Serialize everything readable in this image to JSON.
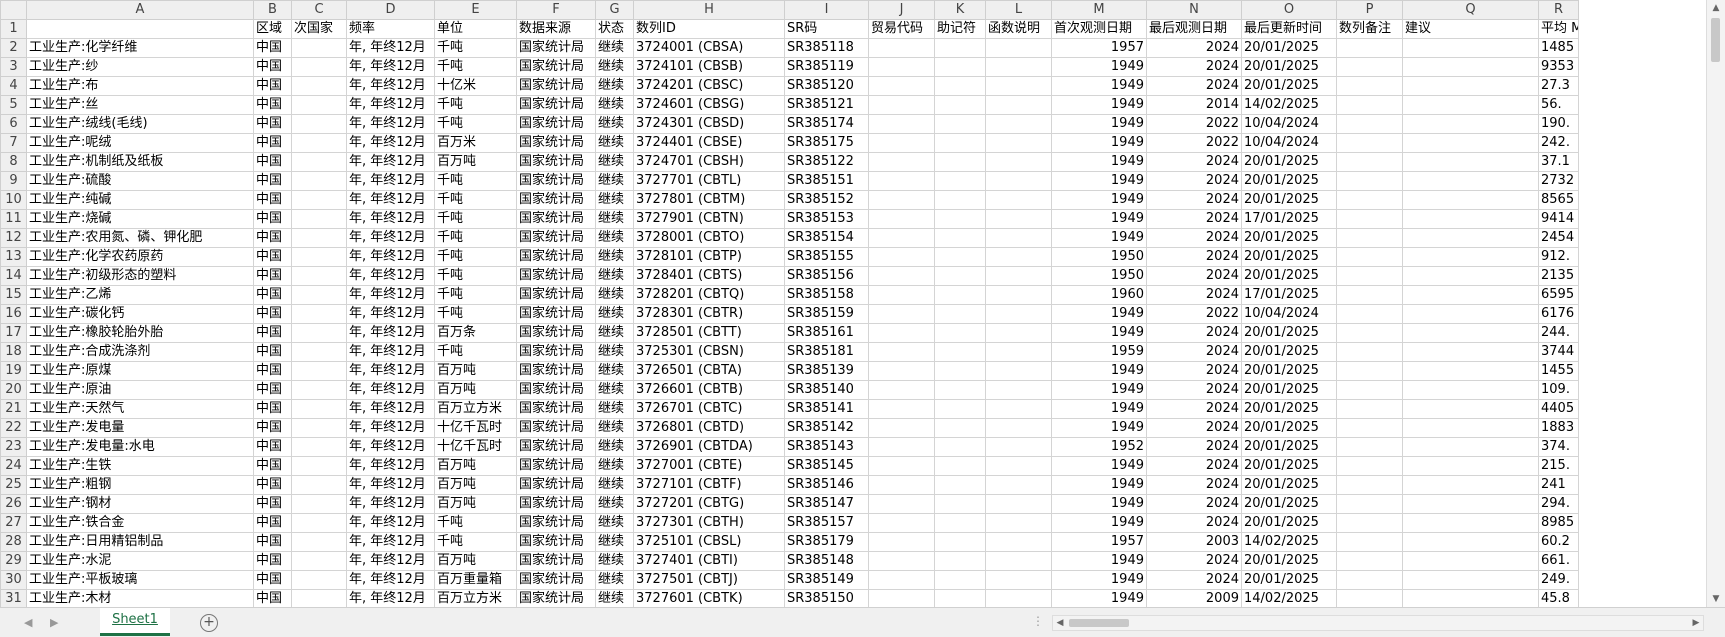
{
  "columns": [
    "",
    "A",
    "B",
    "C",
    "D",
    "E",
    "F",
    "G",
    "H",
    "I",
    "J",
    "K",
    "L",
    "M",
    "N",
    "O",
    "P",
    "Q",
    "R"
  ],
  "rows": [
    {
      "n": "1",
      "cells": [
        "",
        "区域",
        "次国家",
        "频率",
        "单位",
        "数据来源",
        "状态",
        "数列ID",
        "SR码",
        "贸易代码",
        "助记符",
        "函数说明",
        "首次观测日期",
        "最后观测日期",
        "最后更新时间",
        "数列备注",
        "建议",
        "平均 M"
      ]
    },
    {
      "n": "2",
      "cells": [
        "工业生产:化学纤维",
        "中国",
        "",
        "年, 年终12月",
        "千吨",
        "国家统计局",
        "继续",
        "3724001 (CBSA)",
        "SR385118",
        "",
        "",
        "",
        "1957",
        "2024",
        "20/01/2025",
        "",
        "",
        "1485"
      ]
    },
    {
      "n": "3",
      "cells": [
        "工业生产:纱",
        "中国",
        "",
        "年, 年终12月",
        "千吨",
        "国家统计局",
        "继续",
        "3724101 (CBSB)",
        "SR385119",
        "",
        "",
        "",
        "1949",
        "2024",
        "20/01/2025",
        "",
        "",
        "9353"
      ]
    },
    {
      "n": "4",
      "cells": [
        "工业生产:布",
        "中国",
        "",
        "年, 年终12月",
        "十亿米",
        "国家统计局",
        "继续",
        "3724201 (CBSC)",
        "SR385120",
        "",
        "",
        "",
        "1949",
        "2024",
        "20/01/2025",
        "",
        "",
        "27.3"
      ]
    },
    {
      "n": "5",
      "cells": [
        "工业生产:丝",
        "中国",
        "",
        "年, 年终12月",
        "千吨",
        "国家统计局",
        "继续",
        "3724601 (CBSG)",
        "SR385121",
        "",
        "",
        "",
        "1949",
        "2014",
        "14/02/2025",
        "",
        "",
        "56."
      ]
    },
    {
      "n": "6",
      "cells": [
        "工业生产:绒线(毛线)",
        "中国",
        "",
        "年, 年终12月",
        "千吨",
        "国家统计局",
        "继续",
        "3724301 (CBSD)",
        "SR385174",
        "",
        "",
        "",
        "1949",
        "2022",
        "10/04/2024",
        "",
        "",
        "190."
      ]
    },
    {
      "n": "7",
      "cells": [
        "工业生产:呢绒",
        "中国",
        "",
        "年, 年终12月",
        "百万米",
        "国家统计局",
        "继续",
        "3724401 (CBSE)",
        "SR385175",
        "",
        "",
        "",
        "1949",
        "2022",
        "10/04/2024",
        "",
        "",
        "242."
      ]
    },
    {
      "n": "8",
      "cells": [
        "工业生产:机制纸及纸板",
        "中国",
        "",
        "年, 年终12月",
        "百万吨",
        "国家统计局",
        "继续",
        "3724701 (CBSH)",
        "SR385122",
        "",
        "",
        "",
        "1949",
        "2024",
        "20/01/2025",
        "",
        "",
        "37.1"
      ]
    },
    {
      "n": "9",
      "cells": [
        "工业生产:硫酸",
        "中国",
        "",
        "年, 年终12月",
        "千吨",
        "国家统计局",
        "继续",
        "3727701 (CBTL)",
        "SR385151",
        "",
        "",
        "",
        "1949",
        "2024",
        "20/01/2025",
        "",
        "",
        "2732"
      ]
    },
    {
      "n": "10",
      "cells": [
        "工业生产:纯碱",
        "中国",
        "",
        "年, 年终12月",
        "千吨",
        "国家统计局",
        "继续",
        "3727801 (CBTM)",
        "SR385152",
        "",
        "",
        "",
        "1949",
        "2024",
        "20/01/2025",
        "",
        "",
        "8565"
      ]
    },
    {
      "n": "11",
      "cells": [
        "工业生产:烧碱",
        "中国",
        "",
        "年, 年终12月",
        "千吨",
        "国家统计局",
        "继续",
        "3727901 (CBTN)",
        "SR385153",
        "",
        "",
        "",
        "1949",
        "2024",
        "17/01/2025",
        "",
        "",
        "9414"
      ]
    },
    {
      "n": "12",
      "cells": [
        "工业生产:农用氮、磷、钾化肥",
        "中国",
        "",
        "年, 年终12月",
        "千吨",
        "国家统计局",
        "继续",
        "3728001 (CBTO)",
        "SR385154",
        "",
        "",
        "",
        "1949",
        "2024",
        "20/01/2025",
        "",
        "",
        "2454"
      ]
    },
    {
      "n": "13",
      "cells": [
        "工业生产:化学农药原药",
        "中国",
        "",
        "年, 年终12月",
        "千吨",
        "国家统计局",
        "继续",
        "3728101 (CBTP)",
        "SR385155",
        "",
        "",
        "",
        "1950",
        "2024",
        "20/01/2025",
        "",
        "",
        "912."
      ]
    },
    {
      "n": "14",
      "cells": [
        "工业生产:初级形态的塑料",
        "中国",
        "",
        "年, 年终12月",
        "千吨",
        "国家统计局",
        "继续",
        "3728401 (CBTS)",
        "SR385156",
        "",
        "",
        "",
        "1950",
        "2024",
        "20/01/2025",
        "",
        "",
        "2135"
      ]
    },
    {
      "n": "15",
      "cells": [
        "工业生产:乙烯",
        "中国",
        "",
        "年, 年终12月",
        "千吨",
        "国家统计局",
        "继续",
        "3728201 (CBTQ)",
        "SR385158",
        "",
        "",
        "",
        "1960",
        "2024",
        "17/01/2025",
        "",
        "",
        "6595"
      ]
    },
    {
      "n": "16",
      "cells": [
        "工业生产:碳化钙",
        "中国",
        "",
        "年, 年终12月",
        "千吨",
        "国家统计局",
        "继续",
        "3728301 (CBTR)",
        "SR385159",
        "",
        "",
        "",
        "1949",
        "2022",
        "10/04/2024",
        "",
        "",
        "6176"
      ]
    },
    {
      "n": "17",
      "cells": [
        "工业生产:橡胶轮胎外胎",
        "中国",
        "",
        "年, 年终12月",
        "百万条",
        "国家统计局",
        "继续",
        "3728501 (CBTT)",
        "SR385161",
        "",
        "",
        "",
        "1949",
        "2024",
        "20/01/2025",
        "",
        "",
        "244."
      ]
    },
    {
      "n": "18",
      "cells": [
        "工业生产:合成洗涤剂",
        "中国",
        "",
        "年, 年终12月",
        "千吨",
        "国家统计局",
        "继续",
        "3725301 (CBSN)",
        "SR385181",
        "",
        "",
        "",
        "1959",
        "2024",
        "20/01/2025",
        "",
        "",
        "3744"
      ]
    },
    {
      "n": "19",
      "cells": [
        "工业生产:原煤",
        "中国",
        "",
        "年, 年终12月",
        "百万吨",
        "国家统计局",
        "继续",
        "3726501 (CBTA)",
        "SR385139",
        "",
        "",
        "",
        "1949",
        "2024",
        "20/01/2025",
        "",
        "",
        "1455"
      ]
    },
    {
      "n": "20",
      "cells": [
        "工业生产:原油",
        "中国",
        "",
        "年, 年终12月",
        "百万吨",
        "国家统计局",
        "继续",
        "3726601 (CBTB)",
        "SR385140",
        "",
        "",
        "",
        "1949",
        "2024",
        "20/01/2025",
        "",
        "",
        "109."
      ]
    },
    {
      "n": "21",
      "cells": [
        "工业生产:天然气",
        "中国",
        "",
        "年, 年终12月",
        "百万立方米",
        "国家统计局",
        "继续",
        "3726701 (CBTC)",
        "SR385141",
        "",
        "",
        "",
        "1949",
        "2024",
        "20/01/2025",
        "",
        "",
        "4405"
      ]
    },
    {
      "n": "22",
      "cells": [
        "工业生产:发电量",
        "中国",
        "",
        "年, 年终12月",
        "十亿千瓦时",
        "国家统计局",
        "继续",
        "3726801 (CBTD)",
        "SR385142",
        "",
        "",
        "",
        "1949",
        "2024",
        "20/01/2025",
        "",
        "",
        "1883"
      ]
    },
    {
      "n": "23",
      "cells": [
        "工业生产:发电量:水电",
        "中国",
        "",
        "年, 年终12月",
        "十亿千瓦时",
        "国家统计局",
        "继续",
        "3726901 (CBTDA)",
        "SR385143",
        "",
        "",
        "",
        "1952",
        "2024",
        "20/01/2025",
        "",
        "",
        "374."
      ]
    },
    {
      "n": "24",
      "cells": [
        "工业生产:生铁",
        "中国",
        "",
        "年, 年终12月",
        "百万吨",
        "国家统计局",
        "继续",
        "3727001 (CBTE)",
        "SR385145",
        "",
        "",
        "",
        "1949",
        "2024",
        "20/01/2025",
        "",
        "",
        "215."
      ]
    },
    {
      "n": "25",
      "cells": [
        "工业生产:粗钢",
        "中国",
        "",
        "年, 年终12月",
        "百万吨",
        "国家统计局",
        "继续",
        "3727101 (CBTF)",
        "SR385146",
        "",
        "",
        "",
        "1949",
        "2024",
        "20/01/2025",
        "",
        "",
        "241"
      ]
    },
    {
      "n": "26",
      "cells": [
        "工业生产:钢材",
        "中国",
        "",
        "年, 年终12月",
        "百万吨",
        "国家统计局",
        "继续",
        "3727201 (CBTG)",
        "SR385147",
        "",
        "",
        "",
        "1949",
        "2024",
        "20/01/2025",
        "",
        "",
        "294."
      ]
    },
    {
      "n": "27",
      "cells": [
        "工业生产:铁合金",
        "中国",
        "",
        "年, 年终12月",
        "千吨",
        "国家统计局",
        "继续",
        "3727301 (CBTH)",
        "SR385157",
        "",
        "",
        "",
        "1949",
        "2024",
        "20/01/2025",
        "",
        "",
        "8985"
      ]
    },
    {
      "n": "28",
      "cells": [
        "工业生产:日用精铝制品",
        "中国",
        "",
        "年, 年终12月",
        "千吨",
        "国家统计局",
        "继续",
        "3725101 (CBSL)",
        "SR385179",
        "",
        "",
        "",
        "1957",
        "2003",
        "14/02/2025",
        "",
        "",
        "60.2"
      ]
    },
    {
      "n": "29",
      "cells": [
        "工业生产:水泥",
        "中国",
        "",
        "年, 年终12月",
        "百万吨",
        "国家统计局",
        "继续",
        "3727401 (CBTI)",
        "SR385148",
        "",
        "",
        "",
        "1949",
        "2024",
        "20/01/2025",
        "",
        "",
        "661."
      ]
    },
    {
      "n": "30",
      "cells": [
        "工业生产:平板玻璃",
        "中国",
        "",
        "年, 年终12月",
        "百万重量箱",
        "国家统计局",
        "继续",
        "3727501 (CBTJ)",
        "SR385149",
        "",
        "",
        "",
        "1949",
        "2024",
        "20/01/2025",
        "",
        "",
        "249."
      ]
    },
    {
      "n": "31",
      "cells": [
        "工业生产:木材",
        "中国",
        "",
        "年, 年终12月",
        "百万立方米",
        "国家统计局",
        "继续",
        "3727601 (CBTK)",
        "SR385150",
        "",
        "",
        "",
        "1949",
        "2009",
        "14/02/2025",
        "",
        "",
        "45.8"
      ]
    }
  ],
  "sheet_tab": "Sheet1",
  "add_sheet_symbol": "+",
  "scroll_up_symbol": "▲",
  "scroll_down_symbol": "▼",
  "scroll_left_symbol": "◀",
  "scroll_right_symbol": "▶",
  "sheet_prev_symbol": "◀",
  "sheet_next_symbol": "▶",
  "dots_symbol": "⋮"
}
